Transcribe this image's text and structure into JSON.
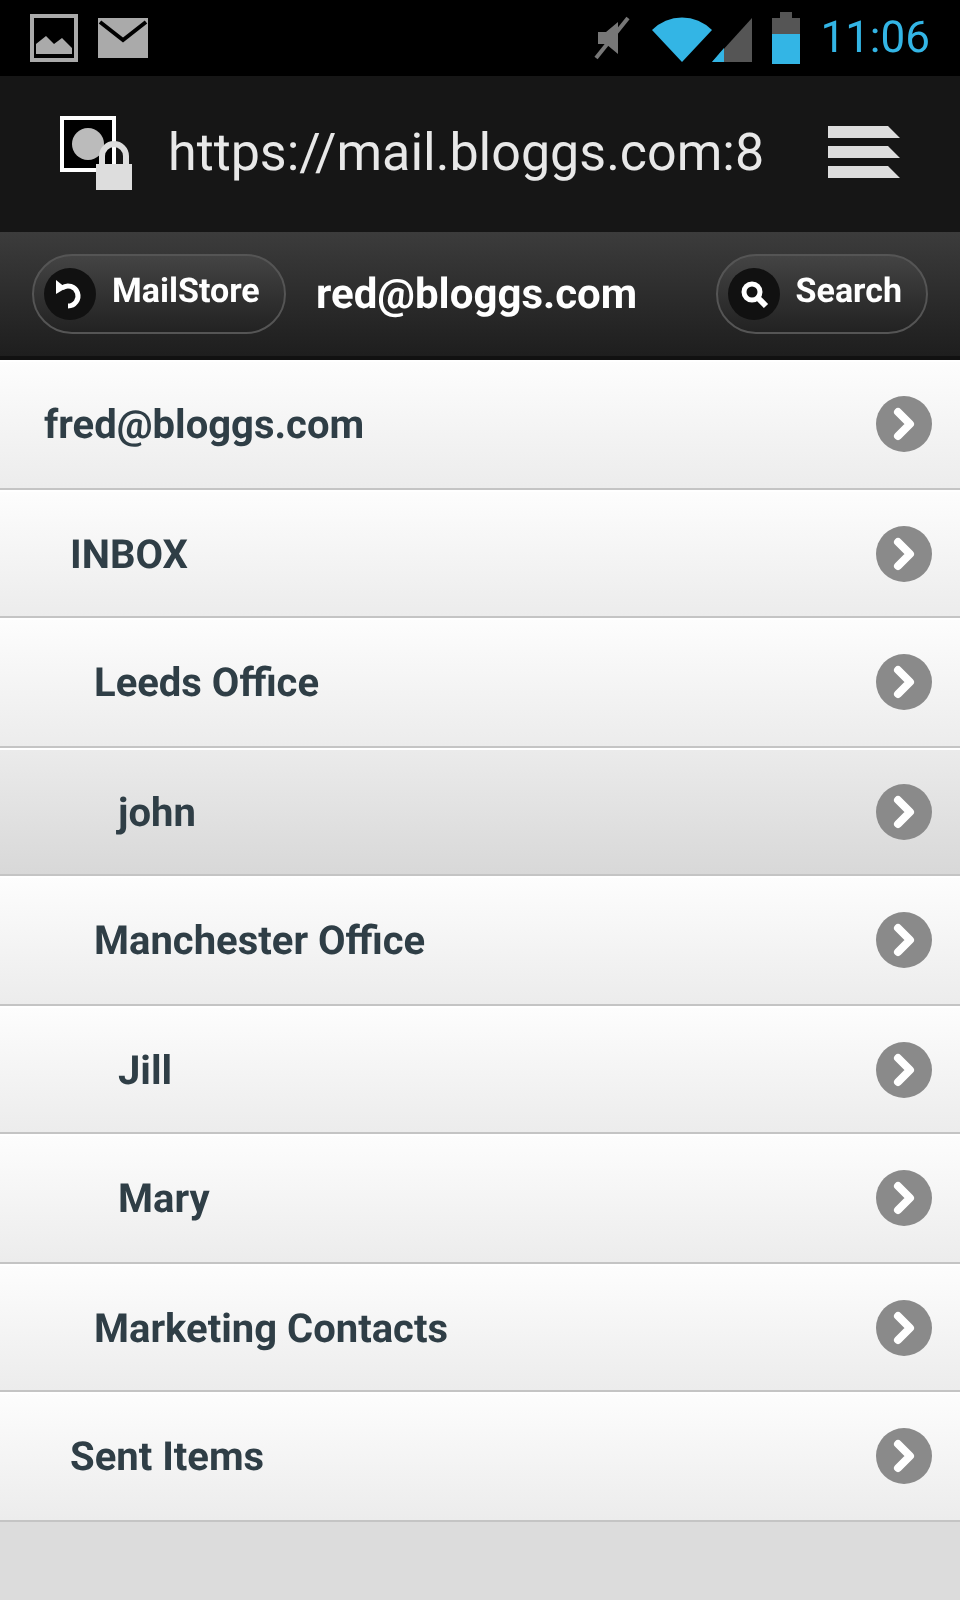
{
  "status_bar": {
    "time": "11:06"
  },
  "browser": {
    "url": "https://mail.bloggs.com:8"
  },
  "header": {
    "title": "red@bloggs.com",
    "back_button": "MailStore",
    "search_button": "Search"
  },
  "folders": [
    {
      "label": "fred@bloggs.com",
      "selected": false,
      "children": [
        {
          "label": "INBOX",
          "selected": false,
          "children": [
            {
              "label": "Leeds Office",
              "selected": false,
              "children": [
                {
                  "label": "john",
                  "selected": true
                }
              ]
            },
            {
              "label": "Manchester Office",
              "selected": false,
              "children": [
                {
                  "label": "Jill",
                  "selected": false
                },
                {
                  "label": "Mary",
                  "selected": false
                }
              ]
            },
            {
              "label": "Marketing Contacts",
              "selected": false
            }
          ]
        },
        {
          "label": "Sent Items",
          "selected": false
        }
      ]
    }
  ]
}
